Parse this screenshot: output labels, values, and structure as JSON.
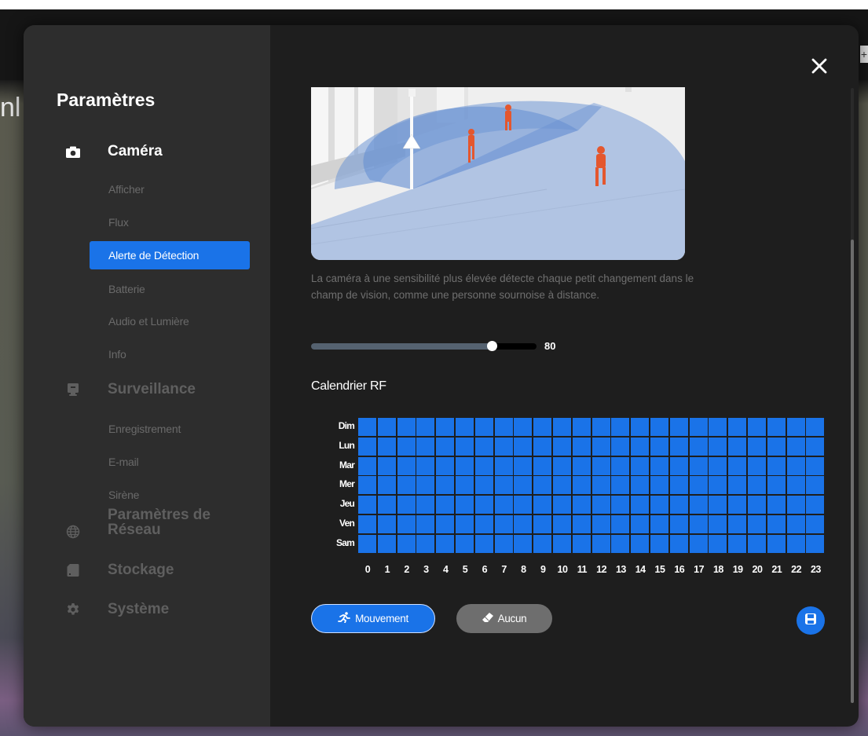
{
  "background": {
    "fragment_text": "nl",
    "corner_icon_label": "+"
  },
  "settings": {
    "title": "Paramètres",
    "close_icon": "close-icon"
  },
  "sidebar": {
    "sections": [
      {
        "label": "Caméra",
        "icon": "camera-icon",
        "active": true,
        "items": [
          {
            "label": "Afficher",
            "selected": false
          },
          {
            "label": "Flux",
            "selected": false
          },
          {
            "label": "Alerte de Détection",
            "selected": true
          },
          {
            "label": "Batterie",
            "selected": false
          },
          {
            "label": "Audio et Lumière",
            "selected": false
          },
          {
            "label": "Info",
            "selected": false
          }
        ]
      },
      {
        "label": "Surveillance",
        "icon": "monitor-icon",
        "active": false,
        "items": [
          {
            "label": "Enregistrement",
            "selected": false
          },
          {
            "label": "E-mail",
            "selected": false
          },
          {
            "label": "Sirène",
            "selected": false
          }
        ]
      },
      {
        "label_line1": "Paramètres de",
        "label_line2": "Réseau",
        "icon": "globe-icon",
        "active": false
      },
      {
        "label": "Stockage",
        "icon": "storage-icon",
        "active": false
      },
      {
        "label": "Système",
        "icon": "gear-icon",
        "active": false
      }
    ]
  },
  "detection": {
    "description": "La caméra à une sensibilité plus élevée détecte chaque petit changement dans le champ de vision, comme une personne sournoise à distance.",
    "sensitivity": 80,
    "sensitivity_max": 100,
    "sensitivity_label": "80"
  },
  "calendar": {
    "title": "Calendrier RF",
    "days": [
      "Dim",
      "Lun",
      "Mar",
      "Mer",
      "Jeu",
      "Ven",
      "Sam"
    ],
    "hours": [
      "0",
      "1",
      "2",
      "3",
      "4",
      "5",
      "6",
      "7",
      "8",
      "9",
      "10",
      "11",
      "12",
      "13",
      "14",
      "15",
      "16",
      "17",
      "18",
      "19",
      "20",
      "21",
      "22",
      "23"
    ],
    "all_cells_active": true,
    "active_color": "#1a73e8"
  },
  "actions": {
    "motion_label": "Mouvement",
    "motion_icon": "running-person-icon",
    "none_label": "Aucun",
    "none_icon": "eraser-icon",
    "save_icon": "save-icon"
  },
  "colors": {
    "accent": "#1a73e8",
    "modal_bg": "#1e1e1e",
    "sidebar_bg": "#2d2d2d"
  }
}
